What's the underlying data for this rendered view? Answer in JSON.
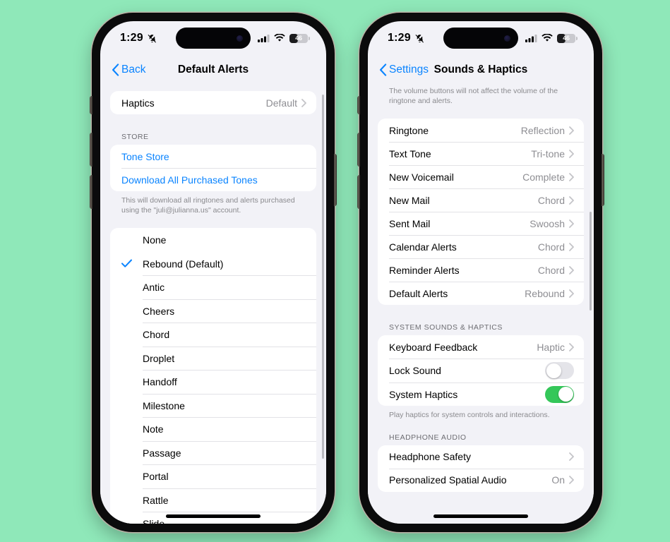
{
  "background_color": "#8fe8b9",
  "accent_color": "#0a84ff",
  "toggle_on_color": "#34c759",
  "status_bar": {
    "time": "1:29",
    "mute_icon": "bell-slash-icon",
    "cellular_icon": "cellular-bars-icon",
    "wifi_icon": "wifi-icon",
    "battery_percent": "46"
  },
  "left_phone": {
    "nav": {
      "back_label": "Back",
      "title": "Default Alerts"
    },
    "haptics_row": {
      "label": "Haptics",
      "value": "Default"
    },
    "store_header": "STORE",
    "store_items": [
      {
        "label": "Tone Store"
      },
      {
        "label": "Download All Purchased Tones"
      }
    ],
    "store_footer": "This will download all ringtones and alerts purchased using the \"juli@julianna.us\" account.",
    "none_item": {
      "label": "None",
      "selected": false
    },
    "tones": [
      {
        "label": "Rebound (Default)",
        "selected": true
      },
      {
        "label": "Antic",
        "selected": false
      },
      {
        "label": "Cheers",
        "selected": false
      },
      {
        "label": "Chord",
        "selected": false
      },
      {
        "label": "Droplet",
        "selected": false
      },
      {
        "label": "Handoff",
        "selected": false
      },
      {
        "label": "Milestone",
        "selected": false
      },
      {
        "label": "Note",
        "selected": false
      },
      {
        "label": "Passage",
        "selected": false
      },
      {
        "label": "Portal",
        "selected": false
      },
      {
        "label": "Rattle",
        "selected": false
      },
      {
        "label": "Slide",
        "selected": false
      }
    ]
  },
  "right_phone": {
    "nav": {
      "back_label": "Settings",
      "title": "Sounds & Haptics"
    },
    "volume_footer": "The volume buttons will not affect the volume of the ringtone and alerts.",
    "sounds_rows": [
      {
        "label": "Ringtone",
        "value": "Reflection"
      },
      {
        "label": "Text Tone",
        "value": "Tri-tone"
      },
      {
        "label": "New Voicemail",
        "value": "Complete"
      },
      {
        "label": "New Mail",
        "value": "Chord"
      },
      {
        "label": "Sent Mail",
        "value": "Swoosh"
      },
      {
        "label": "Calendar Alerts",
        "value": "Chord"
      },
      {
        "label": "Reminder Alerts",
        "value": "Chord"
      },
      {
        "label": "Default Alerts",
        "value": "Rebound"
      }
    ],
    "system_header": "SYSTEM SOUNDS & HAPTICS",
    "system_rows": [
      {
        "label": "Keyboard Feedback",
        "value": "Haptic",
        "type": "disclosure"
      },
      {
        "label": "Lock Sound",
        "type": "toggle",
        "on": false
      },
      {
        "label": "System Haptics",
        "type": "toggle",
        "on": true
      }
    ],
    "system_footer": "Play haptics for system controls and interactions.",
    "headphone_header": "HEADPHONE AUDIO",
    "headphone_rows": [
      {
        "label": "Headphone Safety",
        "value": ""
      },
      {
        "label": "Personalized Spatial Audio",
        "value": "On"
      }
    ]
  }
}
